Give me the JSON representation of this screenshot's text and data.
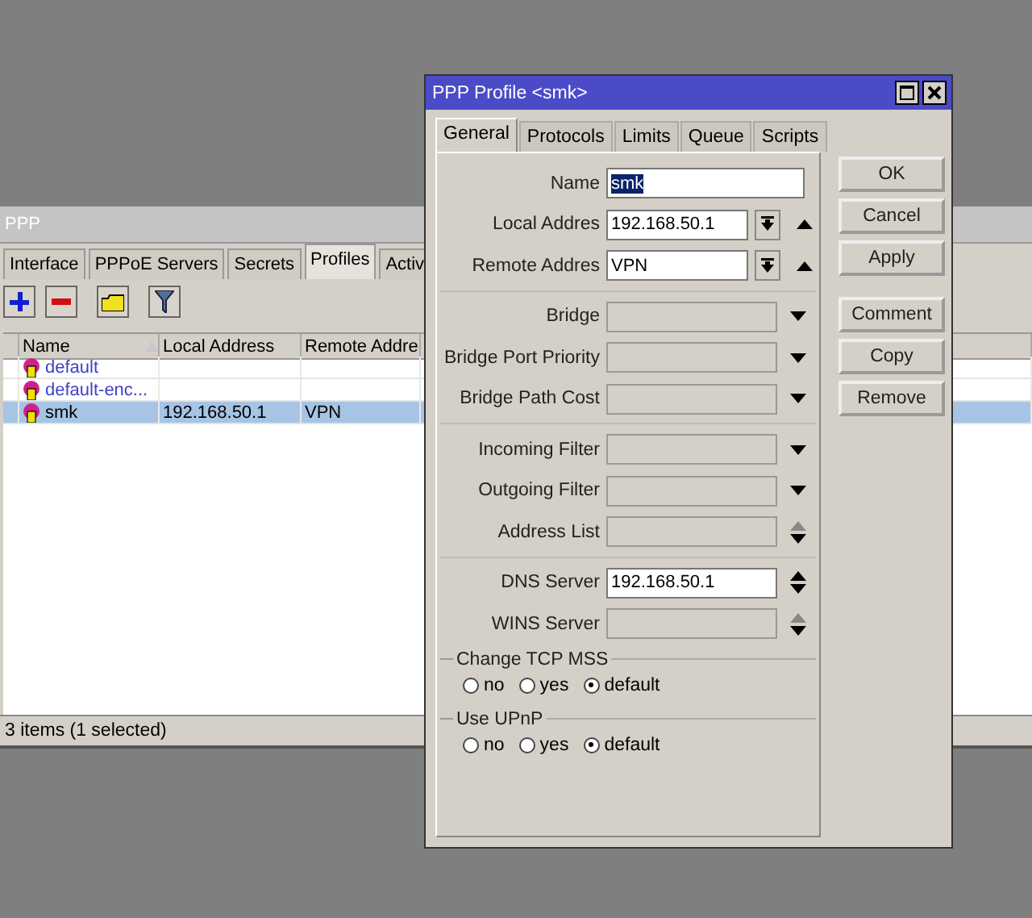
{
  "ppp_window": {
    "title": "PPP",
    "tabs": [
      {
        "label": "Interface",
        "selected": false
      },
      {
        "label": "PPPoE Servers",
        "selected": false
      },
      {
        "label": "Secrets",
        "selected": false
      },
      {
        "label": "Profiles",
        "selected": true
      },
      {
        "label": "Activ",
        "selected": false
      }
    ],
    "table": {
      "columns": [
        "Name",
        "Local Address",
        "Remote Addre"
      ],
      "rows": [
        {
          "cells": [
            "default",
            "",
            ""
          ],
          "builtin": true,
          "selected": false
        },
        {
          "cells": [
            "default-enc...",
            "",
            ""
          ],
          "builtin": true,
          "selected": false
        },
        {
          "cells": [
            "smk",
            "192.168.50.1",
            "VPN"
          ],
          "builtin": false,
          "selected": true
        }
      ]
    },
    "status_bar": "3 items (1 selected)"
  },
  "dialog": {
    "title": "PPP Profile <smk>",
    "tabs": [
      {
        "label": "General",
        "selected": true
      },
      {
        "label": "Protocols",
        "selected": false
      },
      {
        "label": "Limits",
        "selected": false
      },
      {
        "label": "Queue",
        "selected": false
      },
      {
        "label": "Scripts",
        "selected": false
      }
    ],
    "field_groups": [
      [
        {
          "kind": "text",
          "label": "Name",
          "value": "smk",
          "value_selected": true
        },
        {
          "kind": "combo",
          "label": "Local Addres",
          "value": "192.168.50.1"
        },
        {
          "kind": "combo",
          "label": "Remote Addres",
          "value": "VPN"
        }
      ],
      [
        {
          "kind": "dropdown",
          "label": "Bridge"
        },
        {
          "kind": "dropdown",
          "label": "Bridge Port Priority"
        },
        {
          "kind": "dropdown",
          "label": "Bridge Path Cost"
        }
      ],
      [
        {
          "kind": "dropdown",
          "label": "Incoming Filter"
        },
        {
          "kind": "dropdown",
          "label": "Outgoing Filter"
        },
        {
          "kind": "spin",
          "label": "Address List"
        }
      ],
      [
        {
          "kind": "spin",
          "label": "DNS Server",
          "value": "192.168.50.1"
        },
        {
          "kind": "spin",
          "label": "WINS Server"
        }
      ]
    ],
    "radio_groups": [
      {
        "title": "Change TCP MSS",
        "options": [
          {
            "label": "no",
            "selected": false
          },
          {
            "label": "yes",
            "selected": false
          },
          {
            "label": "default",
            "selected": true
          }
        ]
      },
      {
        "title": "Use UPnP",
        "options": [
          {
            "label": "no",
            "selected": false
          },
          {
            "label": "yes",
            "selected": false
          },
          {
            "label": "default",
            "selected": true
          }
        ]
      }
    ],
    "buttons": [
      [
        "OK",
        "Cancel",
        "Apply"
      ],
      [
        "Comment",
        "Copy",
        "Remove"
      ]
    ]
  }
}
